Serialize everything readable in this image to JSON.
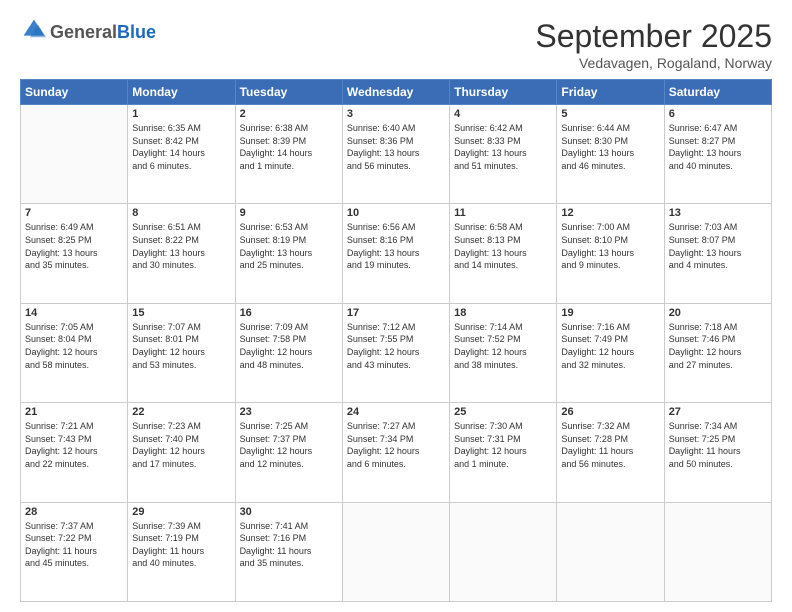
{
  "header": {
    "logo_line1": "General",
    "logo_line2": "Blue",
    "month_title": "September 2025",
    "subtitle": "Vedavagen, Rogaland, Norway"
  },
  "days_of_week": [
    "Sunday",
    "Monday",
    "Tuesday",
    "Wednesday",
    "Thursday",
    "Friday",
    "Saturday"
  ],
  "weeks": [
    [
      {
        "day": "",
        "info": ""
      },
      {
        "day": "1",
        "info": "Sunrise: 6:35 AM\nSunset: 8:42 PM\nDaylight: 14 hours\nand 6 minutes."
      },
      {
        "day": "2",
        "info": "Sunrise: 6:38 AM\nSunset: 8:39 PM\nDaylight: 14 hours\nand 1 minute."
      },
      {
        "day": "3",
        "info": "Sunrise: 6:40 AM\nSunset: 8:36 PM\nDaylight: 13 hours\nand 56 minutes."
      },
      {
        "day": "4",
        "info": "Sunrise: 6:42 AM\nSunset: 8:33 PM\nDaylight: 13 hours\nand 51 minutes."
      },
      {
        "day": "5",
        "info": "Sunrise: 6:44 AM\nSunset: 8:30 PM\nDaylight: 13 hours\nand 46 minutes."
      },
      {
        "day": "6",
        "info": "Sunrise: 6:47 AM\nSunset: 8:27 PM\nDaylight: 13 hours\nand 40 minutes."
      }
    ],
    [
      {
        "day": "7",
        "info": "Sunrise: 6:49 AM\nSunset: 8:25 PM\nDaylight: 13 hours\nand 35 minutes."
      },
      {
        "day": "8",
        "info": "Sunrise: 6:51 AM\nSunset: 8:22 PM\nDaylight: 13 hours\nand 30 minutes."
      },
      {
        "day": "9",
        "info": "Sunrise: 6:53 AM\nSunset: 8:19 PM\nDaylight: 13 hours\nand 25 minutes."
      },
      {
        "day": "10",
        "info": "Sunrise: 6:56 AM\nSunset: 8:16 PM\nDaylight: 13 hours\nand 19 minutes."
      },
      {
        "day": "11",
        "info": "Sunrise: 6:58 AM\nSunset: 8:13 PM\nDaylight: 13 hours\nand 14 minutes."
      },
      {
        "day": "12",
        "info": "Sunrise: 7:00 AM\nSunset: 8:10 PM\nDaylight: 13 hours\nand 9 minutes."
      },
      {
        "day": "13",
        "info": "Sunrise: 7:03 AM\nSunset: 8:07 PM\nDaylight: 13 hours\nand 4 minutes."
      }
    ],
    [
      {
        "day": "14",
        "info": "Sunrise: 7:05 AM\nSunset: 8:04 PM\nDaylight: 12 hours\nand 58 minutes."
      },
      {
        "day": "15",
        "info": "Sunrise: 7:07 AM\nSunset: 8:01 PM\nDaylight: 12 hours\nand 53 minutes."
      },
      {
        "day": "16",
        "info": "Sunrise: 7:09 AM\nSunset: 7:58 PM\nDaylight: 12 hours\nand 48 minutes."
      },
      {
        "day": "17",
        "info": "Sunrise: 7:12 AM\nSunset: 7:55 PM\nDaylight: 12 hours\nand 43 minutes."
      },
      {
        "day": "18",
        "info": "Sunrise: 7:14 AM\nSunset: 7:52 PM\nDaylight: 12 hours\nand 38 minutes."
      },
      {
        "day": "19",
        "info": "Sunrise: 7:16 AM\nSunset: 7:49 PM\nDaylight: 12 hours\nand 32 minutes."
      },
      {
        "day": "20",
        "info": "Sunrise: 7:18 AM\nSunset: 7:46 PM\nDaylight: 12 hours\nand 27 minutes."
      }
    ],
    [
      {
        "day": "21",
        "info": "Sunrise: 7:21 AM\nSunset: 7:43 PM\nDaylight: 12 hours\nand 22 minutes."
      },
      {
        "day": "22",
        "info": "Sunrise: 7:23 AM\nSunset: 7:40 PM\nDaylight: 12 hours\nand 17 minutes."
      },
      {
        "day": "23",
        "info": "Sunrise: 7:25 AM\nSunset: 7:37 PM\nDaylight: 12 hours\nand 12 minutes."
      },
      {
        "day": "24",
        "info": "Sunrise: 7:27 AM\nSunset: 7:34 PM\nDaylight: 12 hours\nand 6 minutes."
      },
      {
        "day": "25",
        "info": "Sunrise: 7:30 AM\nSunset: 7:31 PM\nDaylight: 12 hours\nand 1 minute."
      },
      {
        "day": "26",
        "info": "Sunrise: 7:32 AM\nSunset: 7:28 PM\nDaylight: 11 hours\nand 56 minutes."
      },
      {
        "day": "27",
        "info": "Sunrise: 7:34 AM\nSunset: 7:25 PM\nDaylight: 11 hours\nand 50 minutes."
      }
    ],
    [
      {
        "day": "28",
        "info": "Sunrise: 7:37 AM\nSunset: 7:22 PM\nDaylight: 11 hours\nand 45 minutes."
      },
      {
        "day": "29",
        "info": "Sunrise: 7:39 AM\nSunset: 7:19 PM\nDaylight: 11 hours\nand 40 minutes."
      },
      {
        "day": "30",
        "info": "Sunrise: 7:41 AM\nSunset: 7:16 PM\nDaylight: 11 hours\nand 35 minutes."
      },
      {
        "day": "",
        "info": ""
      },
      {
        "day": "",
        "info": ""
      },
      {
        "day": "",
        "info": ""
      },
      {
        "day": "",
        "info": ""
      }
    ]
  ]
}
